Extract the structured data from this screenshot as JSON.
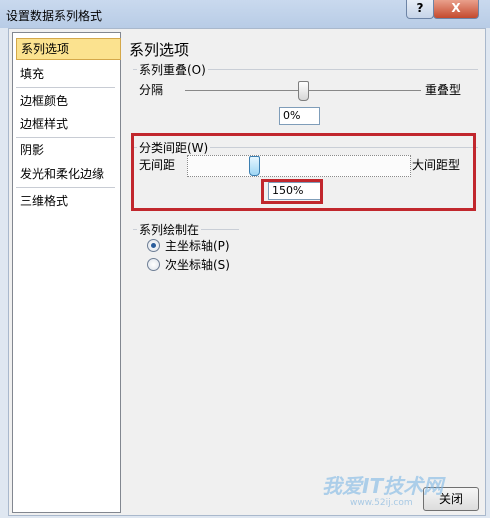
{
  "window": {
    "title": "设置数据系列格式",
    "help_label": "?",
    "close_label": "X"
  },
  "sidebar": {
    "items": [
      {
        "label": "系列选项"
      },
      {
        "label": "填充"
      },
      {
        "label": "边框颜色"
      },
      {
        "label": "边框样式"
      },
      {
        "label": "阴影"
      },
      {
        "label": "发光和柔化边缘"
      },
      {
        "label": "三维格式"
      }
    ]
  },
  "main": {
    "title": "系列选项",
    "series_overlap": {
      "label": "系列重叠(O)",
      "left_label": "分隔",
      "right_label": "重叠型",
      "value": "0%",
      "slider_fraction": 0.5
    },
    "gap_width": {
      "label": "分类间距(W)",
      "left_label": "无间距",
      "right_label": "大间距型",
      "value": "150%",
      "slider_fraction": 0.3
    },
    "plot_on": {
      "label": "系列绘制在",
      "options": [
        {
          "label": "主坐标轴(P)",
          "selected": true
        },
        {
          "label": "次坐标轴(S)",
          "selected": false
        }
      ]
    }
  },
  "footer": {
    "close_button": "关闭"
  },
  "watermark": {
    "text": "我爱IT技术网",
    "url": "www.52ij.com"
  },
  "colors": {
    "highlight_border": "#c1272d",
    "selected_item": "#fbe28f"
  }
}
